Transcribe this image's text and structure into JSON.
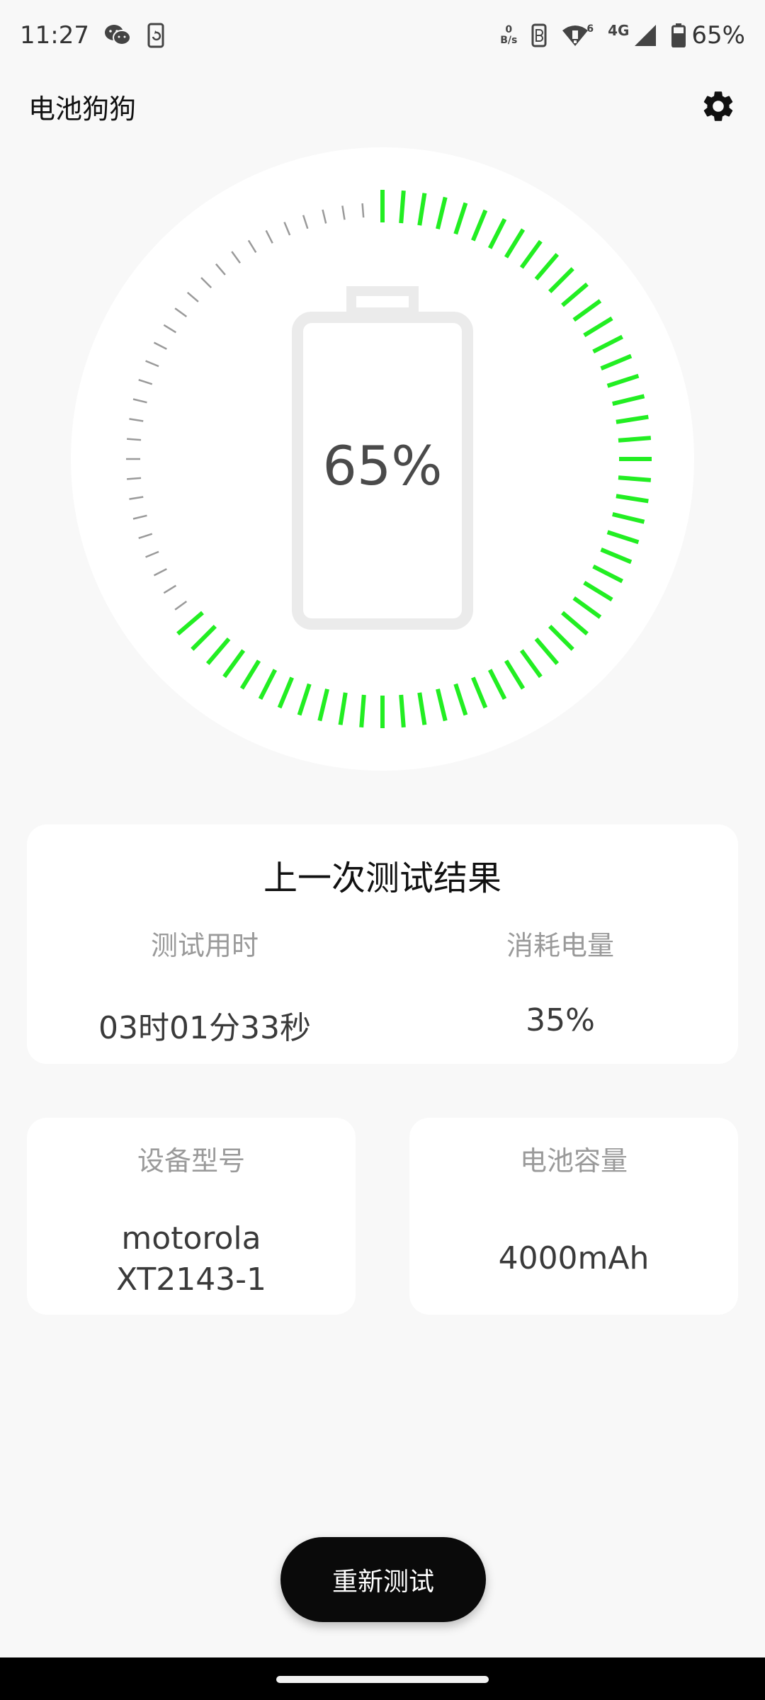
{
  "status_bar": {
    "time": "11:27",
    "net_speed_value": "0",
    "net_speed_unit": "B/s",
    "network_type": "4G",
    "wifi_sub": "6",
    "battery_percent": "65%",
    "icons": [
      "wechat-icon",
      "screen-rotate-icon",
      "net-speed-icon",
      "nfc-icon",
      "wifi-icon",
      "signal-icon",
      "battery-icon"
    ]
  },
  "app_bar": {
    "title": "电池狗狗",
    "settings_icon": "gear-icon"
  },
  "gauge": {
    "percent_text": "65%",
    "level_fraction": 0.65,
    "active_color": "#22ee22",
    "inactive_color": "#9a9a9a"
  },
  "last_result": {
    "title": "上一次测试结果",
    "duration_label": "测试用时",
    "duration_value": "03时01分33秒",
    "consumed_label": "消耗电量",
    "consumed_value": "35%"
  },
  "device": {
    "label": "设备型号",
    "value_line1": "motorola",
    "value_line2": "XT2143-1"
  },
  "capacity": {
    "label": "电池容量",
    "value": "4000mAh"
  },
  "actions": {
    "retest_label": "重新测试"
  },
  "colors": {
    "accent_green": "#22ee22",
    "button_bg": "#0a0a0a",
    "page_bg": "#f8f8f8"
  }
}
